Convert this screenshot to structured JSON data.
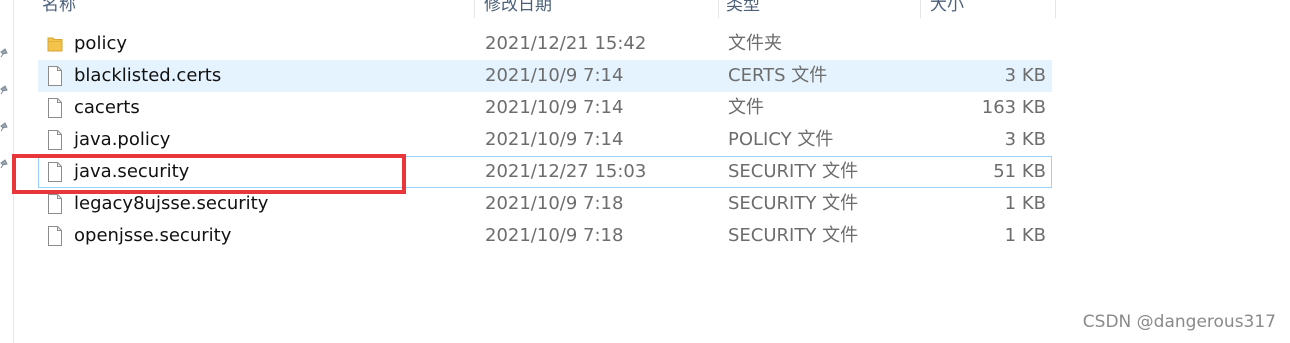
{
  "columns": {
    "name": "名称",
    "date": "修改日期",
    "type": "类型",
    "size": "大小"
  },
  "files": [
    {
      "name": "policy",
      "date": "2021/12/21 15:42",
      "type": "文件夹",
      "size": "",
      "icon": "folder-icon",
      "state": "normal"
    },
    {
      "name": "blacklisted.certs",
      "date": "2021/10/9 7:14",
      "type": "CERTS 文件",
      "size": "3 KB",
      "icon": "file-icon",
      "state": "hover"
    },
    {
      "name": "cacerts",
      "date": "2021/10/9 7:14",
      "type": "文件",
      "size": "163 KB",
      "icon": "file-icon",
      "state": "normal"
    },
    {
      "name": "java.policy",
      "date": "2021/10/9 7:14",
      "type": "POLICY 文件",
      "size": "3 KB",
      "icon": "file-icon",
      "state": "normal"
    },
    {
      "name": "java.security",
      "date": "2021/12/27 15:03",
      "type": "SECURITY 文件",
      "size": "51 KB",
      "icon": "file-icon",
      "state": "outlined"
    },
    {
      "name": "legacy8ujsse.security",
      "date": "2021/10/9 7:18",
      "type": "SECURITY 文件",
      "size": "1 KB",
      "icon": "file-icon",
      "state": "normal"
    },
    {
      "name": "openjsse.security",
      "date": "2021/10/9 7:18",
      "type": "SECURITY 文件",
      "size": "1 KB",
      "icon": "file-icon",
      "state": "normal"
    }
  ],
  "annotation": {
    "color": "#e8363a"
  },
  "watermark": "CSDN @dangerous317"
}
